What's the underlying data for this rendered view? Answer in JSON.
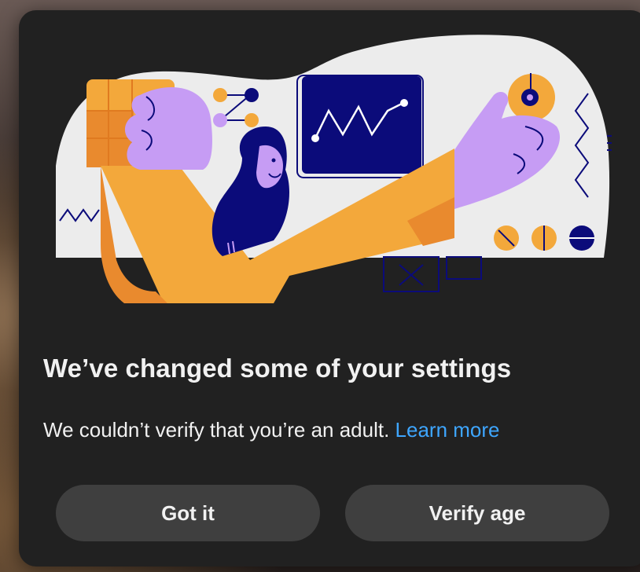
{
  "dialog": {
    "title": "We’ve changed some of your settings",
    "message": "We couldn’t verify that you’re an adult.",
    "learn_more_label": "Learn more",
    "buttons": {
      "got_it_label": "Got it",
      "verify_age_label": "Verify age"
    }
  },
  "colors": {
    "dialog_background": "#212121",
    "button_background": "#3f3f3f",
    "text_primary": "#f1f1f1",
    "link": "#3ea6ff",
    "illustration_orange": "#f3a83b",
    "illustration_purple": "#c69cf4",
    "illustration_navy": "#0b0b7a",
    "illustration_canvas": "#ececec"
  },
  "illustration": {
    "icon": "age-verification-illustration"
  }
}
